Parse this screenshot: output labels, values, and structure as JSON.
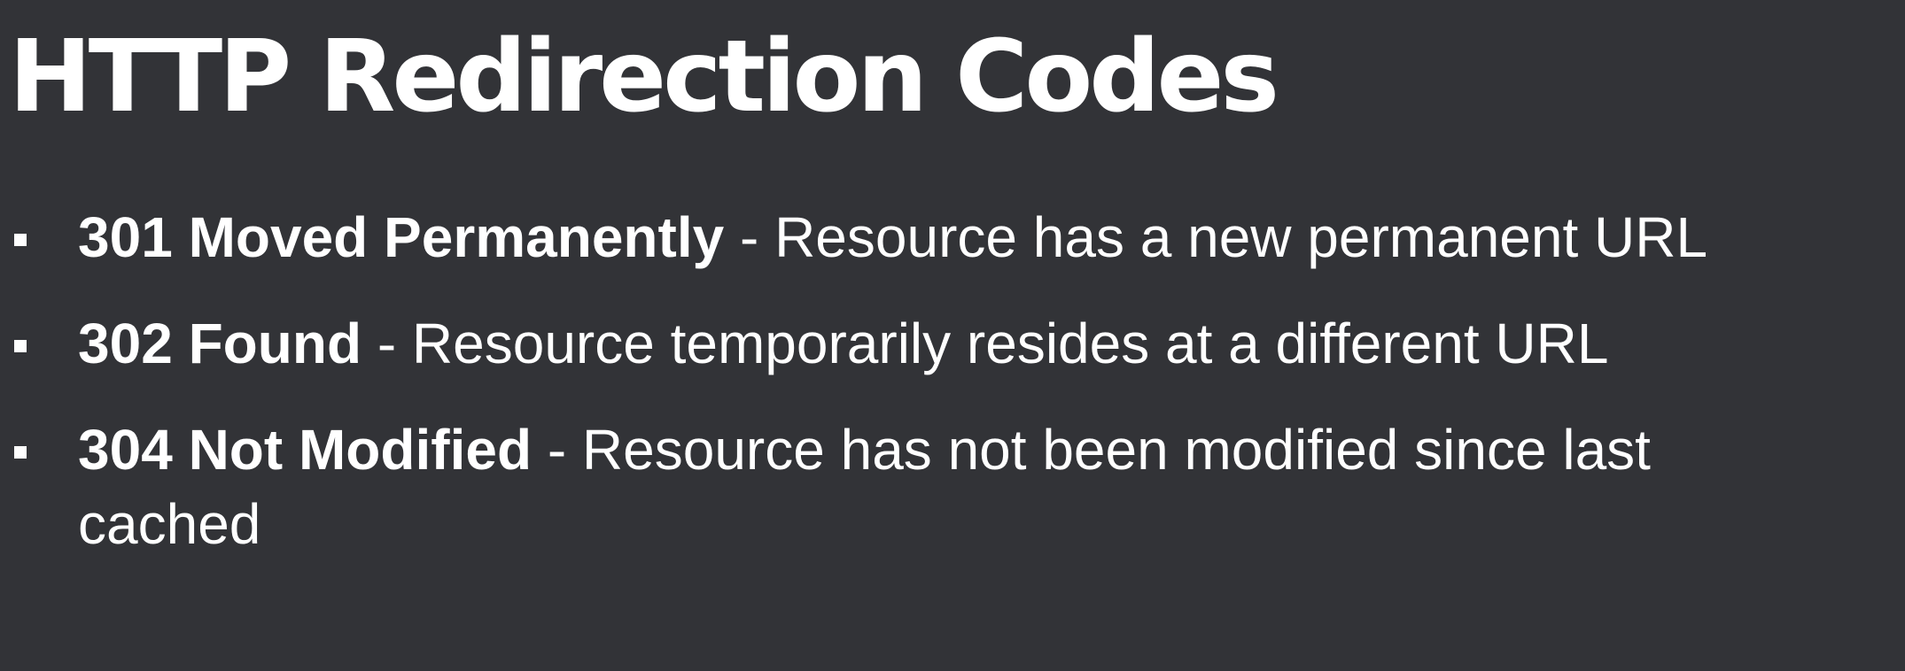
{
  "slide": {
    "title": "HTTP Redirection Codes",
    "items": [
      {
        "code": "301 Moved Permanently",
        "separator": " - ",
        "description": "Resource has a new permanent URL"
      },
      {
        "code": "302 Found",
        "separator": " - ",
        "description": "Resource temporarily resides at a different URL"
      },
      {
        "code": "304 Not Modified",
        "separator": " - ",
        "description": "Resource has not been modified since last cached"
      }
    ]
  }
}
